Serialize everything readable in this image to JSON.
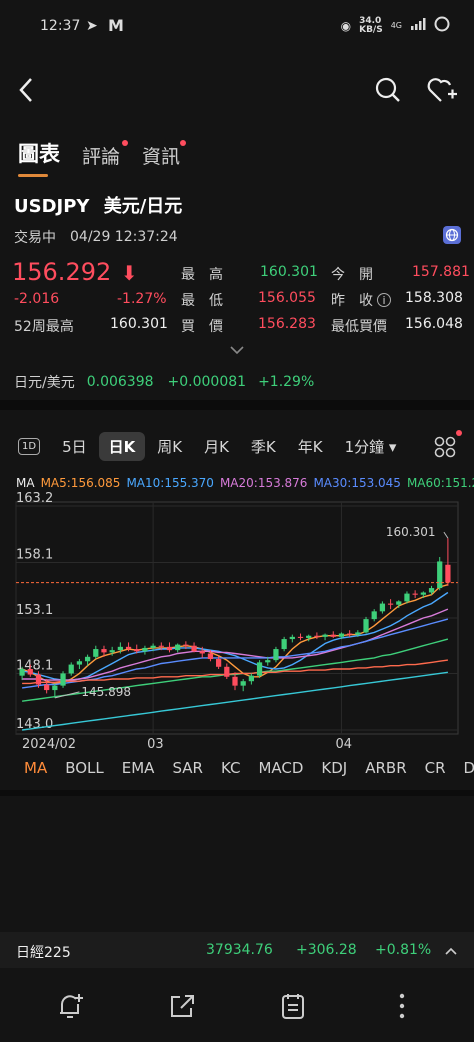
{
  "status": {
    "time": "12:37",
    "network": "34.0\nKB/S",
    "network_speed": "34.0",
    "network_unit": "KB/S",
    "signal": "4G"
  },
  "tabs": [
    {
      "label": "圖表",
      "active": true,
      "badge": false
    },
    {
      "label": "評論",
      "active": false,
      "badge": true
    },
    {
      "label": "資訊",
      "active": false,
      "badge": true
    }
  ],
  "instrument": {
    "symbol": "USDJPY",
    "name": "美元/日元",
    "session": "交易中",
    "datetime": "04/29 12:37:24",
    "price": "156.292",
    "change": "-2.016",
    "change_pct": "-1.27%",
    "week52_label": "52周最高",
    "week52_value": "160.301"
  },
  "quote": {
    "high_label": "最　高",
    "high_value": "160.301",
    "open_label": "今　開",
    "open_value": "157.881",
    "low_label": "最　低",
    "low_value": "156.055",
    "prev_label": "昨　收",
    "prev_value": "158.308",
    "bid_label": "買　價",
    "bid_value": "156.283",
    "lowbid_label": "最低買價",
    "lowbid_value": "156.048"
  },
  "inverse": {
    "label": "日元/美元",
    "price": "0.006398",
    "change": "+0.000081",
    "change_pct": "+1.29%"
  },
  "periods": [
    {
      "label": "1D",
      "boxed": true
    },
    {
      "label": "5日"
    },
    {
      "label": "日K",
      "active": true
    },
    {
      "label": "周K"
    },
    {
      "label": "月K"
    },
    {
      "label": "季K"
    },
    {
      "label": "年K"
    },
    {
      "label": "1分鐘 ▾"
    }
  ],
  "ma_legend": {
    "title": "MA",
    "items": [
      {
        "label": "MA5:156.085",
        "color": "#ff9a3c"
      },
      {
        "label": "MA10:155.370",
        "color": "#4aa8ff"
      },
      {
        "label": "MA20:153.876",
        "color": "#d77bd9"
      },
      {
        "label": "MA30:153.045",
        "color": "#5a8cff"
      },
      {
        "label": "MA60:151.2",
        "color": "#3ecf7a"
      }
    ]
  },
  "chart_data": {
    "type": "candlestick",
    "y_ticks": [
      "163.2",
      "158.1",
      "153.1",
      "148.1",
      "143.0"
    ],
    "x_ticks": [
      "2024/02",
      "03",
      "04"
    ],
    "annotations": {
      "high": "160.301",
      "low": "145.898"
    },
    "ylim": [
      143.0,
      163.2
    ],
    "current_price": 156.292,
    "candles": [
      [
        147.9,
        148.7,
        147.5,
        148.5
      ],
      [
        148.5,
        148.9,
        147.8,
        148.0
      ],
      [
        148.0,
        148.3,
        146.8,
        147.1
      ],
      [
        147.1,
        147.6,
        146.3,
        146.6
      ],
      [
        146.6,
        147.2,
        145.9,
        147.0
      ],
      [
        147.0,
        148.3,
        146.8,
        148.1
      ],
      [
        148.1,
        149.1,
        147.9,
        148.9
      ],
      [
        148.9,
        149.4,
        148.5,
        149.2
      ],
      [
        149.2,
        149.8,
        148.8,
        149.6
      ],
      [
        149.6,
        150.6,
        149.4,
        150.3
      ],
      [
        150.3,
        150.6,
        149.6,
        150.0
      ],
      [
        150.0,
        150.5,
        149.7,
        150.2
      ],
      [
        150.2,
        150.9,
        149.9,
        150.5
      ],
      [
        150.5,
        150.9,
        150.1,
        150.3
      ],
      [
        150.3,
        150.7,
        149.9,
        150.1
      ],
      [
        150.1,
        150.6,
        149.8,
        150.4
      ],
      [
        150.4,
        150.8,
        150.1,
        150.6
      ],
      [
        150.6,
        150.9,
        150.2,
        150.5
      ],
      [
        150.5,
        150.9,
        150.0,
        150.2
      ],
      [
        150.2,
        150.8,
        150.0,
        150.7
      ],
      [
        150.7,
        151.0,
        150.3,
        150.6
      ],
      [
        150.6,
        150.9,
        150.0,
        150.1
      ],
      [
        150.1,
        150.5,
        149.5,
        149.9
      ],
      [
        149.9,
        150.2,
        149.2,
        149.4
      ],
      [
        149.4,
        149.7,
        148.5,
        148.7
      ],
      [
        148.7,
        149.0,
        147.6,
        147.8
      ],
      [
        147.8,
        148.2,
        146.6,
        147.0
      ],
      [
        147.0,
        147.6,
        146.5,
        147.4
      ],
      [
        147.4,
        148.1,
        147.1,
        147.9
      ],
      [
        147.9,
        149.3,
        147.7,
        149.1
      ],
      [
        149.1,
        149.6,
        148.8,
        149.3
      ],
      [
        149.3,
        150.5,
        149.1,
        150.3
      ],
      [
        150.3,
        151.4,
        150.1,
        151.2
      ],
      [
        151.2,
        151.6,
        150.9,
        151.4
      ],
      [
        151.4,
        151.7,
        151.1,
        151.3
      ],
      [
        151.3,
        151.6,
        151.0,
        151.5
      ],
      [
        151.5,
        151.8,
        151.2,
        151.4
      ],
      [
        151.4,
        151.7,
        151.1,
        151.6
      ],
      [
        151.6,
        151.9,
        151.3,
        151.4
      ],
      [
        151.4,
        151.8,
        151.2,
        151.7
      ],
      [
        151.7,
        152.0,
        151.4,
        151.6
      ],
      [
        151.6,
        152.0,
        151.4,
        151.8
      ],
      [
        151.8,
        153.2,
        151.7,
        153.0
      ],
      [
        153.0,
        153.9,
        152.8,
        153.7
      ],
      [
        153.7,
        154.6,
        153.5,
        154.4
      ],
      [
        154.4,
        154.8,
        153.9,
        154.3
      ],
      [
        154.3,
        154.7,
        154.0,
        154.6
      ],
      [
        154.6,
        155.5,
        154.4,
        155.3
      ],
      [
        155.3,
        155.6,
        154.9,
        155.2
      ],
      [
        155.2,
        155.5,
        154.9,
        155.4
      ],
      [
        155.4,
        156.0,
        155.2,
        155.8
      ],
      [
        155.8,
        158.6,
        155.6,
        158.2
      ],
      [
        157.9,
        160.3,
        156.0,
        156.3
      ]
    ],
    "ma_series": [
      {
        "name": "MA5",
        "color": "#ff9a3c",
        "values": [
          148.5,
          148.2,
          147.8,
          147.4,
          147.2,
          147.3,
          147.6,
          148.1,
          148.8,
          149.4,
          149.7,
          149.9,
          150.1,
          150.3,
          150.2,
          150.3,
          150.4,
          150.4,
          150.4,
          150.5,
          150.6,
          150.5,
          150.3,
          150.0,
          149.7,
          149.3,
          148.7,
          148.1,
          147.8,
          147.8,
          148.2,
          148.7,
          149.5,
          150.3,
          150.9,
          151.2,
          151.4,
          151.5,
          151.5,
          151.5,
          151.6,
          151.6,
          151.9,
          152.4,
          153.0,
          153.6,
          154.2,
          154.5,
          154.7,
          155.0,
          155.2,
          155.9,
          156.1
        ]
      },
      {
        "name": "MA10",
        "color": "#4aa8ff",
        "values": [
          148.3,
          148.2,
          148.0,
          147.8,
          147.6,
          147.5,
          147.5,
          147.6,
          147.8,
          148.2,
          148.6,
          149.0,
          149.4,
          149.8,
          150.0,
          150.1,
          150.2,
          150.3,
          150.3,
          150.4,
          150.4,
          150.4,
          150.3,
          150.2,
          150.1,
          149.9,
          149.7,
          149.4,
          149.1,
          148.8,
          148.6,
          148.5,
          148.6,
          148.9,
          149.3,
          149.8,
          150.3,
          150.8,
          151.1,
          151.3,
          151.4,
          151.5,
          151.6,
          151.8,
          152.1,
          152.4,
          152.8,
          153.3,
          153.7,
          154.1,
          154.4,
          154.9,
          155.4
        ]
      },
      {
        "name": "MA20",
        "color": "#d77bd9",
        "values": [
          147.6,
          147.6,
          147.6,
          147.5,
          147.5,
          147.5,
          147.5,
          147.6,
          147.7,
          147.9,
          148.1,
          148.3,
          148.6,
          148.8,
          149.0,
          149.2,
          149.4,
          149.6,
          149.7,
          149.9,
          150.0,
          150.1,
          150.1,
          150.1,
          150.0,
          150.0,
          149.9,
          149.8,
          149.7,
          149.6,
          149.5,
          149.5,
          149.5,
          149.5,
          149.6,
          149.7,
          149.8,
          150.0,
          150.2,
          150.4,
          150.6,
          150.8,
          151.0,
          151.3,
          151.6,
          151.9,
          152.2,
          152.5,
          152.8,
          153.1,
          153.3,
          153.6,
          153.9
        ]
      },
      {
        "name": "MA30",
        "color": "#5a8cff",
        "values": [
          146.8,
          146.9,
          147.0,
          147.1,
          147.1,
          147.2,
          147.3,
          147.4,
          147.5,
          147.6,
          147.8,
          147.9,
          148.1,
          148.3,
          148.5,
          148.6,
          148.8,
          149.0,
          149.1,
          149.2,
          149.3,
          149.4,
          149.5,
          149.5,
          149.5,
          149.5,
          149.5,
          149.5,
          149.5,
          149.5,
          149.5,
          149.6,
          149.6,
          149.7,
          149.8,
          149.9,
          150.0,
          150.1,
          150.3,
          150.5,
          150.6,
          150.8,
          151.0,
          151.2,
          151.4,
          151.6,
          151.8,
          152.0,
          152.2,
          152.4,
          152.6,
          152.8,
          153.0
        ]
      },
      {
        "name": "MA60",
        "color": "#3ecf7a",
        "values": [
          145.6,
          145.7,
          145.8,
          145.9,
          146.0,
          146.1,
          146.2,
          146.3,
          146.4,
          146.5,
          146.6,
          146.7,
          146.8,
          146.9,
          147.0,
          147.1,
          147.2,
          147.3,
          147.4,
          147.5,
          147.6,
          147.7,
          147.8,
          147.8,
          147.9,
          148.0,
          148.0,
          148.1,
          148.1,
          148.2,
          148.3,
          148.3,
          148.4,
          148.5,
          148.6,
          148.7,
          148.8,
          148.9,
          149.0,
          149.1,
          149.2,
          149.3,
          149.4,
          149.5,
          149.7,
          149.8,
          150.0,
          150.2,
          150.4,
          150.6,
          150.8,
          151.0,
          151.2
        ]
      },
      {
        "name": "MA120",
        "color": "#ff6a4d",
        "values": [
          147.2,
          147.2,
          147.3,
          147.3,
          147.3,
          147.4,
          147.4,
          147.4,
          147.5,
          147.5,
          147.5,
          147.6,
          147.6,
          147.6,
          147.7,
          147.7,
          147.7,
          147.8,
          147.8,
          147.8,
          147.9,
          147.9,
          147.9,
          148.0,
          148.0,
          148.0,
          148.1,
          148.1,
          148.1,
          148.2,
          148.2,
          148.2,
          148.3,
          148.3,
          148.3,
          148.4,
          148.4,
          148.4,
          148.5,
          148.5,
          148.5,
          148.6,
          148.6,
          148.7,
          148.7,
          148.8,
          148.8,
          148.9,
          148.9,
          149.0,
          149.1,
          149.2,
          149.3
        ]
      },
      {
        "name": "MA250",
        "color": "#37c8d6",
        "values": [
          143.0,
          143.1,
          143.2,
          143.3,
          143.4,
          143.5,
          143.6,
          143.7,
          143.8,
          143.9,
          144.0,
          144.1,
          144.2,
          144.3,
          144.4,
          144.5,
          144.6,
          144.7,
          144.8,
          144.9,
          145.0,
          145.1,
          145.2,
          145.3,
          145.4,
          145.5,
          145.6,
          145.7,
          145.8,
          145.9,
          146.0,
          146.1,
          146.2,
          146.3,
          146.4,
          146.5,
          146.6,
          146.7,
          146.8,
          146.9,
          147.0,
          147.1,
          147.2,
          147.3,
          147.4,
          147.5,
          147.6,
          147.7,
          147.8,
          147.9,
          148.0,
          148.1,
          148.2
        ]
      }
    ]
  },
  "indicators": [
    {
      "label": "MA",
      "active": true
    },
    {
      "label": "BOLL"
    },
    {
      "label": "EMA"
    },
    {
      "label": "SAR"
    },
    {
      "label": "KC"
    },
    {
      "label": "MACD"
    },
    {
      "label": "KDJ"
    },
    {
      "label": "ARBR"
    },
    {
      "label": "CR"
    },
    {
      "label": "DMI"
    }
  ],
  "ticker": {
    "name": "日經225",
    "price": "37934.76",
    "change": "+306.28",
    "change_pct": "+0.81%"
  }
}
